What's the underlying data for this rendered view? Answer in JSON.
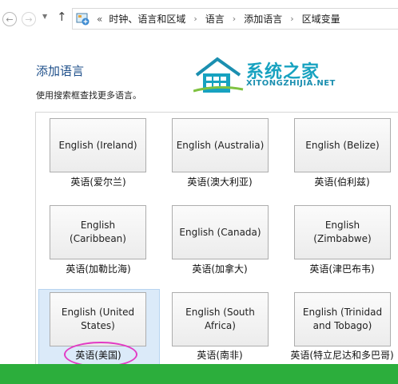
{
  "address_bar": {
    "back_glyph": "←",
    "forward_glyph": "→",
    "up_glyph": "↑",
    "overflow": "«",
    "crumbs": [
      "时钟、语言和区域",
      "语言",
      "添加语言",
      "区域变量"
    ]
  },
  "page": {
    "title": "添加语言",
    "subtitle": "使用搜索框查找更多语言。"
  },
  "watermark": {
    "name": "系统之家",
    "url": "XITONGZHIJIA.NET"
  },
  "languages": [
    {
      "name": "English (Ireland)",
      "caption": "英语(爱尔兰)"
    },
    {
      "name": "English (Australia)",
      "caption": "英语(澳大利亚)"
    },
    {
      "name": "English (Belize)",
      "caption": "英语(伯利兹)"
    },
    {
      "name": "English (Caribbean)",
      "caption": "英语(加勒比海)"
    },
    {
      "name": "English (Canada)",
      "caption": "英语(加拿大)"
    },
    {
      "name": "English (Zimbabwe)",
      "caption": "英语(津巴布韦)"
    },
    {
      "name": "English (United States)",
      "caption": "英语(美国)"
    },
    {
      "name": "English (South Africa)",
      "caption": "英语(南非)"
    },
    {
      "name": "English (Trinidad and Tobago)",
      "caption": "英语(特立尼达和多巴哥)"
    }
  ],
  "selected_index": 6,
  "colors": {
    "title": "#1e4f8a",
    "selection": "#dbeaf9",
    "annotation_circle": "#e23bc4",
    "bottom_bar": "#2cae3c",
    "logo": "#17a2c0"
  }
}
